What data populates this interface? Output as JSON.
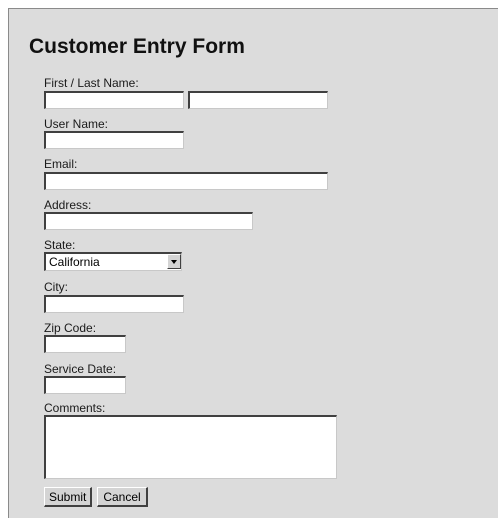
{
  "form": {
    "title": "Customer Entry Form",
    "labels": {
      "name": "First / Last Name:",
      "username": "User Name:",
      "email": "Email:",
      "address": "Address:",
      "state": "State:",
      "city": "City:",
      "zip": "Zip Code:",
      "service_date": "Service Date:",
      "comments": "Comments:"
    },
    "values": {
      "first_name": "",
      "last_name": "",
      "username": "",
      "email": "",
      "address": "",
      "state": "California",
      "city": "",
      "zip": "",
      "service_date": "",
      "comments": ""
    },
    "buttons": {
      "submit": "Submit",
      "cancel": "Cancel"
    }
  },
  "colors": {
    "panel_background": "#dcdcdc",
    "field_background": "#ffffff",
    "button_face": "#d4d4d4"
  }
}
